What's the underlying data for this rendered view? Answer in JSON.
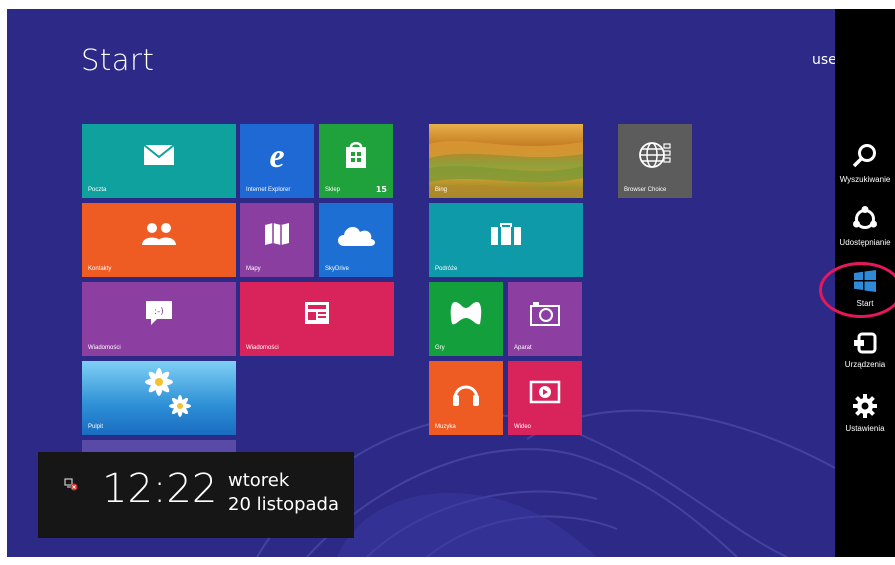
{
  "screen": {
    "title": "Start",
    "user": "use"
  },
  "tiles": {
    "poczta": {
      "label": "Poczta",
      "icon": "mail-icon",
      "color": "#0ea19e"
    },
    "ie": {
      "label": "Internet Explorer",
      "icon": "internet-explorer-icon",
      "color": "#1e69d3"
    },
    "sklep": {
      "label": "Sklep",
      "badge": "15",
      "icon": "store-icon",
      "color": "#1fa23b"
    },
    "kontakty": {
      "label": "Kontakty",
      "icon": "people-icon",
      "color": "#ee5b23"
    },
    "mapy": {
      "label": "Mapy",
      "icon": "maps-icon",
      "color": "#8a3ea0"
    },
    "skydrive": {
      "label": "SkyDrive",
      "icon": "cloud-icon",
      "color": "#1e6fd3"
    },
    "wiadomosci1": {
      "label": "Wiadomości",
      "icon": "messaging-icon",
      "color": "#8c3fa0"
    },
    "wiadomosci2": {
      "label": "Wiadomości",
      "icon": "news-icon",
      "color": "#d8245a"
    },
    "pulpit": {
      "label": "Pulpit",
      "icon": "desktop-icon",
      "color": "#3aa6e0"
    },
    "bing": {
      "label": "Bing",
      "icon": "bing-photo",
      "color": "#c98b2b"
    },
    "podroze": {
      "label": "Podróże",
      "icon": "travel-icon",
      "color": "#0e9aa8"
    },
    "gry": {
      "label": "Gry",
      "icon": "games-icon",
      "color": "#13a03c"
    },
    "aparat": {
      "label": "Aparat",
      "icon": "camera-icon",
      "color": "#8c3fa0"
    },
    "muzyka": {
      "label": "Muzyka",
      "icon": "headphones-icon",
      "color": "#ee5b23"
    },
    "wideo": {
      "label": "Wideo",
      "icon": "video-icon",
      "color": "#d8245a"
    },
    "browser": {
      "label": "Browser Choice",
      "icon": "globe-icon",
      "color": "#5c5c5c"
    }
  },
  "charms": {
    "search": {
      "label": "Wyszukiwanie",
      "icon": "search-icon"
    },
    "share": {
      "label": "Udostępnianie",
      "icon": "share-icon"
    },
    "start": {
      "label": "Start",
      "icon": "windows-icon"
    },
    "devices": {
      "label": "Urządzenia",
      "icon": "devices-icon"
    },
    "settings": {
      "label": "Ustawienia",
      "icon": "gear-icon"
    }
  },
  "clock": {
    "time": "12:22",
    "day": "wtorek",
    "date": "20 listopada",
    "icon": "network-status-icon"
  },
  "colors": {
    "background": "#2c2a86",
    "charm_bar": "#000000",
    "highlight": "#e6185b"
  }
}
